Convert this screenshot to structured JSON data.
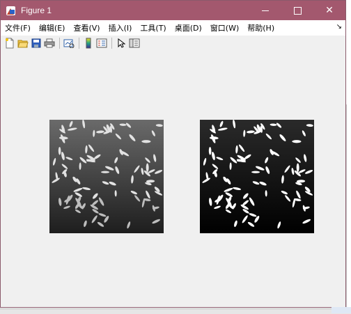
{
  "window": {
    "title": "Figure 1",
    "title_bar_color": "#a3586e"
  },
  "menu": {
    "items": [
      "文件(F)",
      "编辑(E)",
      "查看(V)",
      "插入(I)",
      "工具(T)",
      "桌面(D)",
      "窗口(W)",
      "帮助(H)"
    ],
    "overflow_arrow": "↘"
  },
  "toolbar": {
    "buttons": [
      "new-figure-icon",
      "open-file-icon",
      "save-icon",
      "print-icon",
      "link-plot-icon",
      "insert-colorbar-icon",
      "insert-legend-icon",
      "pointer-icon",
      "property-inspector-icon"
    ]
  },
  "figure": {
    "images": [
      {
        "label": "grayscale rice image"
      },
      {
        "label": "contrast-enhanced rice image"
      }
    ]
  }
}
